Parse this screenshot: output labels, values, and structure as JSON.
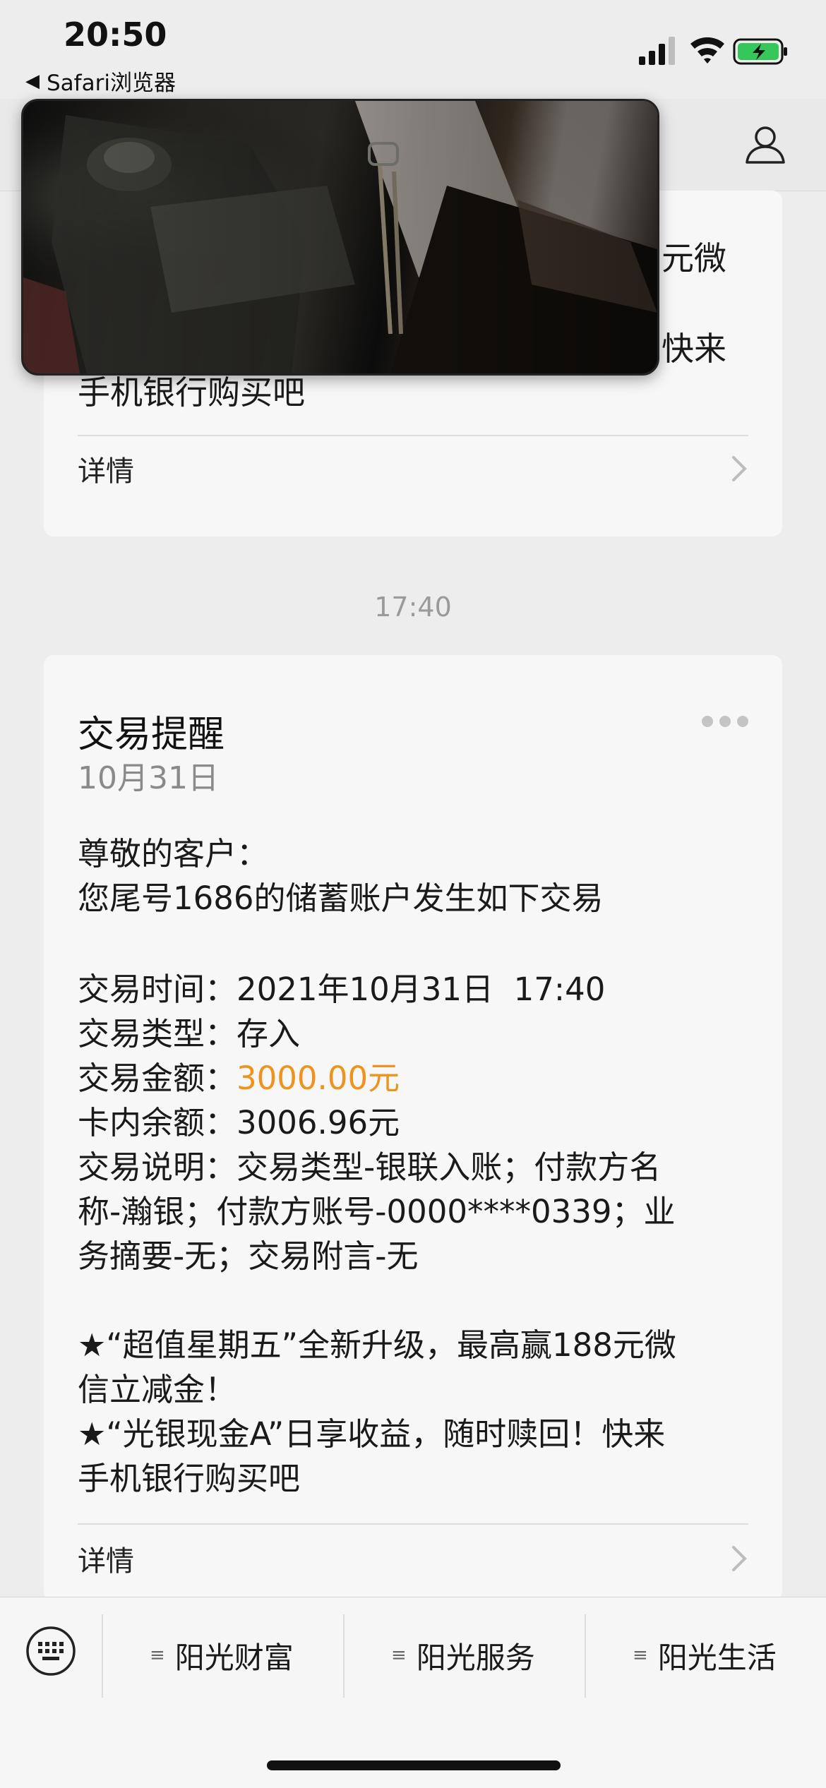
{
  "status_bar": {
    "time": "20:50",
    "back_app": "Safari浏览器",
    "back_icon": "back-triangle-icon",
    "battery_charging": true
  },
  "colors": {
    "accent_orange": "#f0921e",
    "background": "#ededed",
    "card": "#f7f7f7"
  },
  "card1": {
    "partial_line1": "元微",
    "partial_line2": "快来",
    "line3": "手机银行购买吧",
    "details_label": "详情"
  },
  "timestamp": "17:40",
  "card2": {
    "title": "交易提醒",
    "date": "10月31日",
    "greeting": "尊敬的客户：",
    "intro": "您尾号1686的储蓄账户发生如下交易",
    "time_label": "交易时间：",
    "time_value": "2021年10月31日  17:40",
    "type_label": "交易类型：",
    "type_value": "存入",
    "amount_label": "交易金额：",
    "amount_value": "3000.00元",
    "balance_label": "卡内余额：",
    "balance_value": "3006.96元",
    "desc_label": "交易说明：",
    "desc_line1": "交易类型-银联入账；付款方名",
    "desc_line2": "称-瀚银；付款方账号-0000****0339；业",
    "desc_line3": "务摘要-无；交易附言-无",
    "promo1_line1": "★“超值星期五”全新升级，最高赢188元微",
    "promo1_line2": "信立减金！",
    "promo2_line1": "★“光银现金A”日享收益，随时赎回！快来",
    "promo2_line2": "手机银行购买吧",
    "details_label": "详情"
  },
  "bottom_menu": {
    "items": [
      {
        "label": "阳光财富"
      },
      {
        "label": "阳光服务"
      },
      {
        "label": "阳光生活"
      }
    ],
    "menu_icon": "≡"
  }
}
